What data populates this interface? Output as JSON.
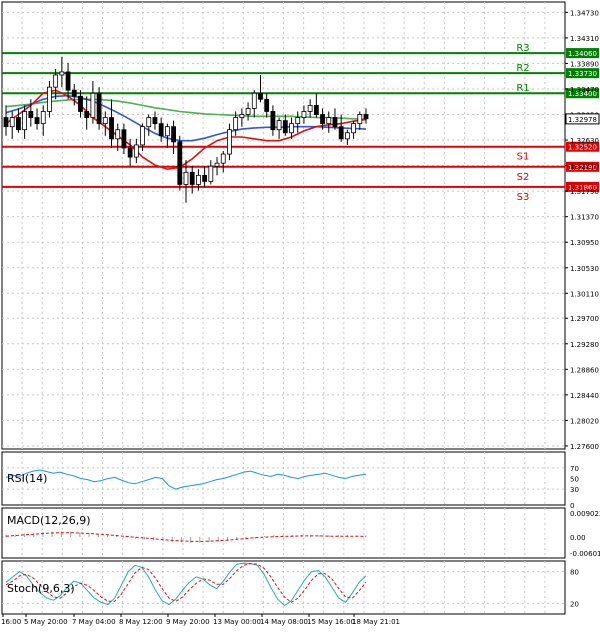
{
  "chart_data": {
    "type": "candlestick",
    "instrument_price": "1.32978",
    "y_ticks": [
      "1.34730",
      "1.34310",
      "1.33890",
      "1.33470",
      "1.33050",
      "1.32630",
      "1.32210",
      "1.31790",
      "1.31370",
      "1.30950",
      "1.30530",
      "1.30110",
      "1.29700",
      "1.29280",
      "1.28860",
      "1.28440",
      "1.28020",
      "1.27600"
    ],
    "ylim": [
      1.2755,
      1.349
    ],
    "x_ticks": [
      "16:00",
      "5 May 20:00",
      "7 May 04:00",
      "8 May 12:00",
      "9 May 20:00",
      "13 May 00:00",
      "14 May 08:00",
      "15 May 16:00",
      "18 May 21:01"
    ],
    "levels": [
      {
        "name": "R3",
        "value": 1.3406,
        "label": "1.34060",
        "color": "#008000"
      },
      {
        "name": "R2",
        "value": 1.3373,
        "label": "1.33730",
        "color": "#008000"
      },
      {
        "name": "R1",
        "value": 1.334,
        "label": "1.33400",
        "color": "#008000"
      },
      {
        "name": "S1",
        "value": 1.3252,
        "label": "1.32520",
        "color": "#e00000"
      },
      {
        "name": "S2",
        "value": 1.3219,
        "label": "1.32190",
        "color": "#e00000"
      },
      {
        "name": "S3",
        "value": 1.3186,
        "label": "1.31860",
        "color": "#e00000"
      }
    ],
    "candles": [
      [
        1.33,
        1.332,
        1.327,
        1.3285
      ],
      [
        1.3285,
        1.331,
        1.3265,
        1.33
      ],
      [
        1.33,
        1.3315,
        1.3275,
        1.328
      ],
      [
        1.328,
        1.332,
        1.3265,
        1.331
      ],
      [
        1.331,
        1.333,
        1.3285,
        1.33
      ],
      [
        1.33,
        1.3315,
        1.328,
        1.329
      ],
      [
        1.329,
        1.332,
        1.327,
        1.331
      ],
      [
        1.331,
        1.336,
        1.33,
        1.335
      ],
      [
        1.335,
        1.338,
        1.333,
        1.337
      ],
      [
        1.337,
        1.34,
        1.335,
        1.3375
      ],
      [
        1.3375,
        1.339,
        1.333,
        1.3345
      ],
      [
        1.3345,
        1.3355,
        1.332,
        1.3335
      ],
      [
        1.3335,
        1.3345,
        1.33,
        1.331
      ],
      [
        1.331,
        1.3335,
        1.328,
        1.33
      ],
      [
        1.33,
        1.336,
        1.329,
        1.334
      ],
      [
        1.334,
        1.335,
        1.328,
        1.329
      ],
      [
        1.329,
        1.331,
        1.327,
        1.33
      ],
      [
        1.33,
        1.333,
        1.325,
        1.3265
      ],
      [
        1.3265,
        1.329,
        1.3245,
        1.328
      ],
      [
        1.328,
        1.329,
        1.324,
        1.325
      ],
      [
        1.325,
        1.3265,
        1.322,
        1.3235
      ],
      [
        1.3235,
        1.3265,
        1.3225,
        1.3255
      ],
      [
        1.3255,
        1.329,
        1.3245,
        1.3285
      ],
      [
        1.3285,
        1.3305,
        1.327,
        1.33
      ],
      [
        1.33,
        1.331,
        1.328,
        1.329
      ],
      [
        1.329,
        1.33,
        1.326,
        1.327
      ],
      [
        1.327,
        1.329,
        1.325,
        1.3285
      ],
      [
        1.3285,
        1.3295,
        1.324,
        1.326
      ],
      [
        1.326,
        1.327,
        1.318,
        1.319
      ],
      [
        1.319,
        1.323,
        1.316,
        1.321
      ],
      [
        1.321,
        1.322,
        1.3175,
        1.319
      ],
      [
        1.319,
        1.3215,
        1.318,
        1.3205
      ],
      [
        1.3205,
        1.322,
        1.3185,
        1.3195
      ],
      [
        1.3195,
        1.323,
        1.319,
        1.322
      ],
      [
        1.322,
        1.3235,
        1.3205,
        1.3225
      ],
      [
        1.3225,
        1.3245,
        1.321,
        1.324
      ],
      [
        1.324,
        1.329,
        1.323,
        1.328
      ],
      [
        1.328,
        1.331,
        1.327,
        1.33
      ],
      [
        1.33,
        1.3315,
        1.3285,
        1.3305
      ],
      [
        1.3305,
        1.3325,
        1.3295,
        1.3315
      ],
      [
        1.3315,
        1.3345,
        1.33,
        1.334
      ],
      [
        1.334,
        1.337,
        1.3325,
        1.333
      ],
      [
        1.333,
        1.334,
        1.33,
        1.331
      ],
      [
        1.331,
        1.332,
        1.327,
        1.328
      ],
      [
        1.328,
        1.33,
        1.3265,
        1.3295
      ],
      [
        1.3295,
        1.3305,
        1.327,
        1.3275
      ],
      [
        1.3275,
        1.33,
        1.3265,
        1.329
      ],
      [
        1.329,
        1.331,
        1.3275,
        1.33
      ],
      [
        1.33,
        1.332,
        1.329,
        1.331
      ],
      [
        1.331,
        1.333,
        1.33,
        1.332
      ],
      [
        1.332,
        1.334,
        1.33,
        1.3305
      ],
      [
        1.3305,
        1.3315,
        1.328,
        1.329
      ],
      [
        1.329,
        1.331,
        1.3275,
        1.33
      ],
      [
        1.33,
        1.3315,
        1.328,
        1.3285
      ],
      [
        1.3285,
        1.3305,
        1.326,
        1.3265
      ],
      [
        1.3265,
        1.328,
        1.3255,
        1.3275
      ],
      [
        1.3275,
        1.3295,
        1.3265,
        1.329
      ],
      [
        1.329,
        1.331,
        1.328,
        1.3305
      ],
      [
        1.3305,
        1.3315,
        1.329,
        1.3298
      ]
    ],
    "ma_slow": [
      1.3318,
      1.332,
      1.3322,
      1.3325,
      1.3327,
      1.3329,
      1.333,
      1.333,
      1.3329,
      1.3327,
      1.3324,
      1.332,
      1.3316,
      1.3313,
      1.331,
      1.3308,
      1.3306,
      1.3305,
      1.3304,
      1.3303,
      1.3302,
      1.3302,
      1.3302,
      1.3302,
      1.3301,
      1.33,
      1.33,
      1.3299,
      1.3298,
      1.3297
    ],
    "ma_mid": [
      1.3308,
      1.3314,
      1.3322,
      1.333,
      1.3335,
      1.3336,
      1.3333,
      1.3327,
      1.3318,
      1.3308,
      1.3297,
      1.3285,
      1.3274,
      1.3266,
      1.3262,
      1.3262,
      1.3266,
      1.3272,
      1.3277,
      1.3281,
      1.3283,
      1.3284,
      1.3284,
      1.3285,
      1.3285,
      1.3285,
      1.3284,
      1.3283,
      1.3282,
      1.3281
    ],
    "ma_fast": [
      1.329,
      1.3305,
      1.332,
      1.334,
      1.3345,
      1.3335,
      1.332,
      1.33,
      1.3285,
      1.327,
      1.3255,
      1.3235,
      1.3222,
      1.3215,
      1.3218,
      1.3232,
      1.325,
      1.3262,
      1.3268,
      1.3268,
      1.3265,
      1.3262,
      1.3262,
      1.3268,
      1.3278,
      1.3285,
      1.3288,
      1.329,
      1.3294,
      1.3297
    ],
    "rsi": {
      "label": "RSI(14)",
      "ylim": [
        0,
        100
      ],
      "ticks": [
        "70",
        "50",
        "30",
        "0"
      ],
      "values": [
        52,
        56,
        54,
        60,
        64,
        66,
        63,
        60,
        62,
        58,
        55,
        50,
        48,
        44,
        46,
        50,
        52,
        47,
        42,
        40,
        44,
        48,
        52,
        50,
        36,
        30,
        34,
        36,
        38,
        40,
        44,
        48,
        50,
        54,
        58,
        62,
        64,
        60,
        56,
        54,
        58,
        56,
        52,
        50,
        54,
        56,
        58,
        60,
        56,
        52,
        50,
        54,
        56,
        58
      ]
    },
    "macd": {
      "label": "MACD(12,26,9)",
      "ylim": [
        -0.008,
        0.011
      ],
      "ticks": [
        "0.009022",
        "0.00",
        "-0.006013"
      ],
      "hist": [
        0.0004,
        0.0006,
        0.0009,
        0.0012,
        0.0015,
        0.0017,
        0.0017,
        0.0016,
        0.0014,
        0.0012,
        0.0009,
        0.0006,
        0.0003,
        0.0,
        -0.0003,
        -0.0006,
        -0.0009,
        -0.0012,
        -0.0015,
        -0.0017,
        -0.0018,
        -0.0018,
        -0.0016,
        -0.0014,
        -0.0012,
        -0.0008,
        -0.0005,
        -0.0002,
        0.0,
        0.0002,
        0.0003,
        0.0004,
        0.0004,
        0.0004,
        0.0003,
        0.0003,
        0.0003,
        0.0003,
        0.0002,
        0.0002
      ],
      "signal": [
        0.0003,
        0.0005,
        0.0008,
        0.001,
        0.0013,
        0.0015,
        0.0016,
        0.0016,
        0.0015,
        0.0013,
        0.0011,
        0.0008,
        0.0005,
        0.0002,
        -0.0001,
        -0.0004,
        -0.0007,
        -0.001,
        -0.0013,
        -0.0015,
        -0.0017,
        -0.0017,
        -0.0016,
        -0.0014,
        -0.0012,
        -0.0009,
        -0.0006,
        -0.0003,
        -0.0001,
        0.0001,
        0.0002,
        0.0003,
        0.0004,
        0.0004,
        0.0004,
        0.0003,
        0.0003,
        0.0003,
        0.0003,
        0.0002
      ]
    },
    "stoch": {
      "label": "Stoch(9,6,3)",
      "ylim": [
        0,
        100
      ],
      "ticks": [
        "80",
        "20"
      ],
      "main": [
        60,
        70,
        80,
        72,
        55,
        40,
        30,
        26,
        35,
        50,
        62,
        58,
        44,
        30,
        22,
        18,
        30,
        55,
        80,
        92,
        88,
        70,
        45,
        25,
        18,
        28,
        45,
        60,
        70,
        66,
        55,
        48,
        62,
        80,
        94,
        96,
        95,
        92,
        75,
        50,
        28,
        16,
        25,
        45,
        65,
        80,
        82,
        70,
        50,
        30,
        22,
        40,
        60,
        72
      ],
      "signal": [
        55,
        62,
        72,
        75,
        68,
        55,
        42,
        32,
        30,
        40,
        52,
        58,
        54,
        44,
        32,
        24,
        24,
        38,
        58,
        78,
        88,
        84,
        68,
        48,
        30,
        24,
        32,
        46,
        58,
        66,
        64,
        56,
        56,
        68,
        82,
        92,
        95,
        94,
        86,
        70,
        50,
        32,
        22,
        30,
        46,
        64,
        76,
        76,
        66,
        48,
        32,
        30,
        44,
        60
      ]
    }
  }
}
